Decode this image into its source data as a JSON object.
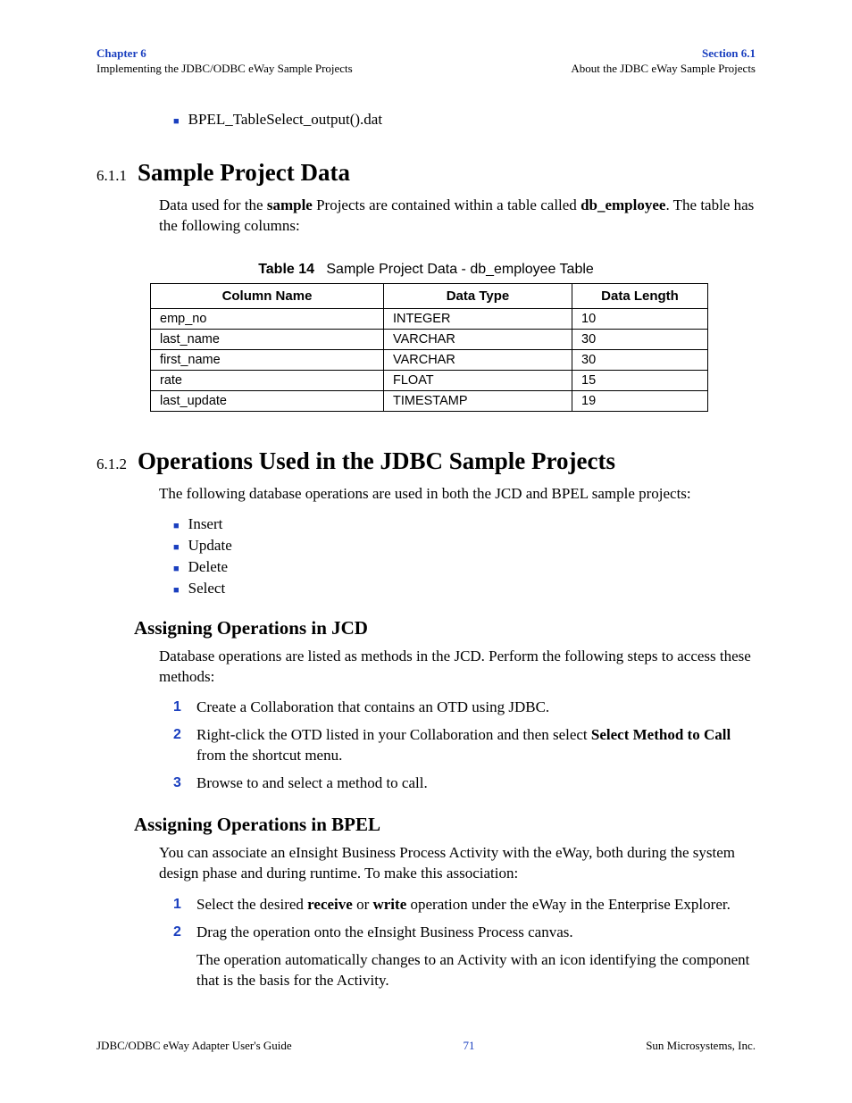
{
  "header": {
    "left_line1": "Chapter 6",
    "left_line2": "Implementing the JDBC/ODBC eWay Sample Projects",
    "right_line1": "Section 6.1",
    "right_line2": "About the JDBC eWay Sample Projects"
  },
  "top_bullet": "BPEL_TableSelect_output().dat",
  "sec611": {
    "num": "6.1.1",
    "title": "Sample Project Data",
    "para_pre": "Data used for the ",
    "para_bold1": "sample",
    "para_mid": " Projects are contained within a table called ",
    "para_bold2": "db_employee",
    "para_post": ". The table has the following columns:"
  },
  "table14": {
    "caption_label": "Table 14",
    "caption_text": "Sample Project Data - db_employee Table",
    "headers": [
      "Column Name",
      "Data Type",
      "Data Length"
    ],
    "rows": [
      [
        "emp_no",
        "INTEGER",
        "10"
      ],
      [
        "last_name",
        "VARCHAR",
        "30"
      ],
      [
        "first_name",
        "VARCHAR",
        "30"
      ],
      [
        "rate",
        "FLOAT",
        "15"
      ],
      [
        "last_update",
        "TIMESTAMP",
        "19"
      ]
    ]
  },
  "sec612": {
    "num": "6.1.2",
    "title": "Operations Used in the JDBC Sample Projects",
    "intro": "The following database operations are used in both the JCD and BPEL sample projects:",
    "ops": [
      "Insert",
      "Update",
      "Delete",
      "Select"
    ]
  },
  "jcd": {
    "heading": "Assigning Operations in JCD",
    "intro": "Database operations are listed as methods in the JCD. Perform the following steps to access these methods:",
    "step1": "Create a Collaboration that contains an OTD using JDBC.",
    "step2_pre": "Right-click the OTD listed in your Collaboration and then select ",
    "step2_bold": "Select Method to Call",
    "step2_post": " from the shortcut menu.",
    "step3": "Browse to and select a method to call."
  },
  "bpel": {
    "heading": "Assigning Operations in BPEL",
    "intro": "You can associate an eInsight Business Process Activity with the eWay, both during the system design phase and during runtime. To make this association:",
    "step1_pre": "Select the desired ",
    "step1_b1": "receive",
    "step1_mid": " or ",
    "step1_b2": "write",
    "step1_post": " operation under the eWay in the Enterprise Explorer.",
    "step2": "Drag the operation onto the eInsight Business Process canvas.",
    "step2_follow": "The operation automatically changes to an Activity with an icon identifying the component that is the basis for the Activity."
  },
  "footer": {
    "left": "JDBC/ODBC eWay Adapter User's Guide",
    "center": "71",
    "right": "Sun Microsystems, Inc."
  }
}
